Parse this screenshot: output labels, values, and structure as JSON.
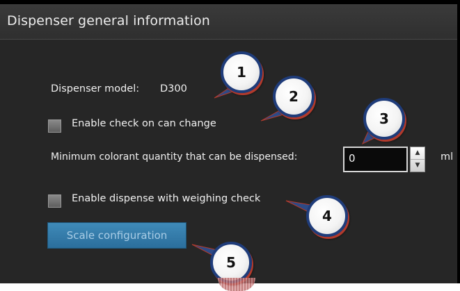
{
  "panel": {
    "title": "Dispenser general information"
  },
  "model": {
    "label": "Dispenser model:",
    "value": "D300"
  },
  "check_can_change": {
    "label": "Enable check on can change",
    "checked": false
  },
  "min_quantity": {
    "label": "Minimum colorant quantity that can be dispensed:",
    "value": "0",
    "unit": "ml"
  },
  "weighing_check": {
    "label": "Enable dispense with weighing check",
    "checked": false
  },
  "scale_button": {
    "label": "Scale configuration"
  },
  "callouts": [
    "1",
    "2",
    "3",
    "4",
    "5"
  ],
  "colors": {
    "panel_background": "#262626",
    "button_blue": "#3478a8",
    "callout_border": "#1f3c7a",
    "callout_shadow": "#b23a2c"
  },
  "icons": {
    "stepper_up": "chevron-up-icon",
    "stepper_down": "chevron-down-icon"
  }
}
